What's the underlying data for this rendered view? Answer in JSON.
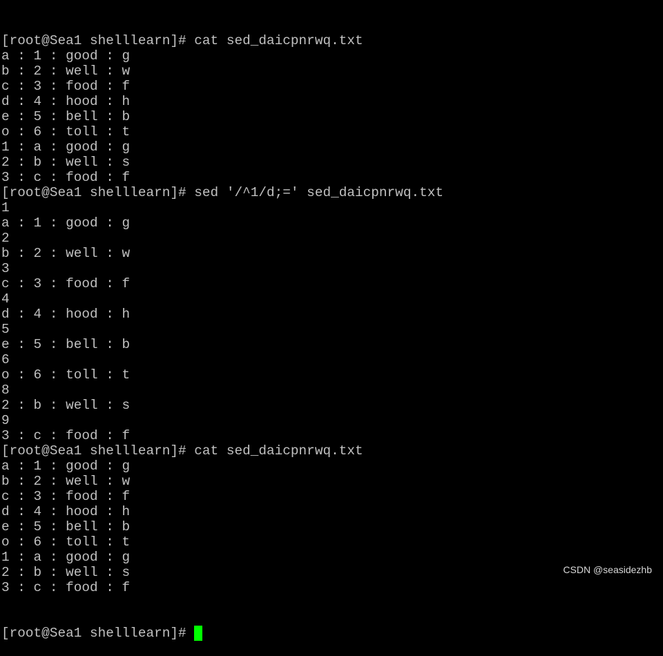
{
  "terminal": {
    "lines": [
      "[root@Sea1 shelllearn]# cat sed_daicpnrwq.txt",
      "a : 1 : good : g",
      "b : 2 : well : w",
      "c : 3 : food : f",
      "d : 4 : hood : h",
      "e : 5 : bell : b",
      "o : 6 : toll : t",
      "1 : a : good : g",
      "2 : b : well : s",
      "3 : c : food : f",
      "[root@Sea1 shelllearn]# sed '/^1/d;=' sed_daicpnrwq.txt",
      "1",
      "a : 1 : good : g",
      "2",
      "b : 2 : well : w",
      "3",
      "c : 3 : food : f",
      "4",
      "d : 4 : hood : h",
      "5",
      "e : 5 : bell : b",
      "6",
      "o : 6 : toll : t",
      "8",
      "2 : b : well : s",
      "9",
      "3 : c : food : f",
      "[root@Sea1 shelllearn]# cat sed_daicpnrwq.txt",
      "a : 1 : good : g",
      "b : 2 : well : w",
      "c : 3 : food : f",
      "d : 4 : hood : h",
      "e : 5 : bell : b",
      "o : 6 : toll : t",
      "1 : a : good : g",
      "2 : b : well : s",
      "3 : c : food : f"
    ],
    "prompt": "[root@Sea1 shelllearn]#",
    "cursor_color": "#00ff00",
    "text_color": "#c0c0c0",
    "background": "#000000"
  },
  "watermark": "CSDN @seasidezhb"
}
